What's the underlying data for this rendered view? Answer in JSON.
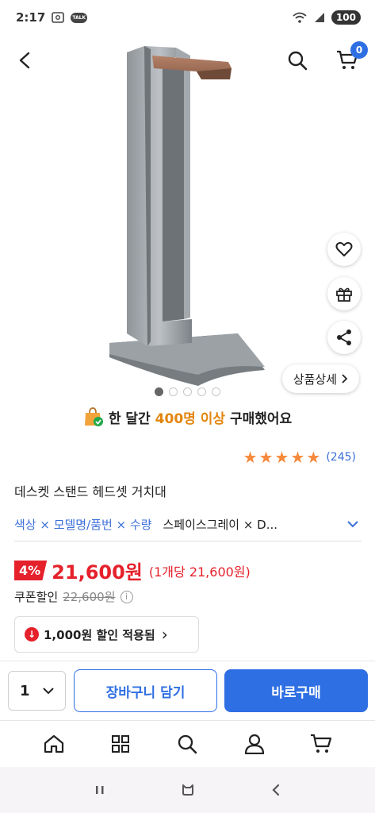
{
  "status": {
    "time": "2:17",
    "talk_badge": "TALK",
    "battery": "100"
  },
  "header": {
    "cart_count": "0"
  },
  "gallery": {
    "detail_button_label": "상품상세",
    "dot_count": 5,
    "active_index": 0
  },
  "promo": {
    "prefix": "한 달간",
    "highlight": "400명 이상",
    "suffix": "구매했어요"
  },
  "rating": {
    "stars": 5,
    "review_count": "(245)"
  },
  "product": {
    "title": "데스켓 스탠드 헤드셋 거치대"
  },
  "options": {
    "labels": "색상 × 모델명/품번 × 수량",
    "value": "스페이스그레이 × D..."
  },
  "price": {
    "discount_rate": "4%",
    "sale_price": "21,600원",
    "unit_price": "(1개당 21,600원)",
    "coupon_label": "쿠폰할인",
    "original_price": "22,600원",
    "info_symbol": "i"
  },
  "coupon_box": {
    "label": "1,000원 할인 적용됨",
    "arrow": "›"
  },
  "buy_bar": {
    "quantity": "1",
    "cart_label": "장바구니 담기",
    "buy_label": "바로구매"
  },
  "colors": {
    "accent_blue": "#2f6fe4",
    "price_red": "#e5212b",
    "star_orange": "#f6893a",
    "promo_orange": "#e3860f"
  }
}
